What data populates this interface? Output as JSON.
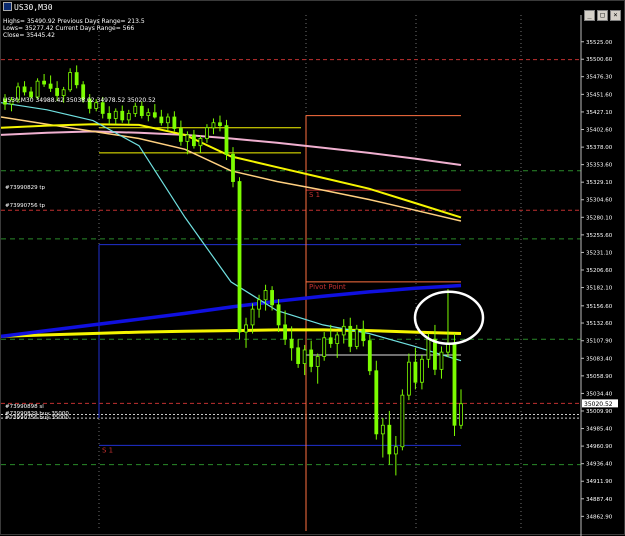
{
  "window": {
    "title": "US30,M30",
    "buttons": [
      "_",
      "□",
      "×"
    ]
  },
  "chart_header": {
    "symbol_line": "US30,M30  34988.42 35038.02 34978.52 35020.52",
    "info_lines": [
      "Highs= 35490.92   Previous Days Range= 213.5",
      "Lows= 35277.42   Current Days Range= 566",
      "Close= 35445.42"
    ]
  },
  "colors": {
    "background": "#000000",
    "candle": "#7cfc00",
    "ema_blue": "#1010e0",
    "ema_yellow": "#f5f500",
    "ma_pink": "#f0b0d0",
    "ma_orange": "#ffb000",
    "ma_gold": "#ffd080",
    "ma_cyan": "#70e0e0",
    "level_red": "#c03030",
    "level_green": "#2a8a2a",
    "pivot_orange": "#ff7040",
    "highlight_circle": "#ffffff"
  },
  "chart_data": {
    "type": "candlestick",
    "title": "US30,M30",
    "ylim": [
      34862.0,
      35540.0
    ],
    "y_ticks": [
      "35525.00",
      "35500.60",
      "35476.30",
      "35451.60",
      "35427.10",
      "35402.60",
      "35378.00",
      "35353.60",
      "35329.10",
      "35304.60",
      "35280.10",
      "35255.60",
      "35231.10",
      "35206.60",
      "35182.10",
      "35156.60",
      "35132.60",
      "35107.90",
      "35083.40",
      "35058.90",
      "35034.40",
      "35009.90",
      "34985.40",
      "34960.90",
      "34936.40",
      "34911.90",
      "34887.40",
      "34862.90"
    ],
    "current_price": "35020.52",
    "candles_ohlc": [
      [
        35445,
        35452,
        35430,
        35438
      ],
      [
        35438,
        35448,
        35428,
        35444
      ],
      [
        35444,
        35468,
        35440,
        35462
      ],
      [
        35462,
        35470,
        35450,
        35455
      ],
      [
        35455,
        35462,
        35445,
        35448
      ],
      [
        35448,
        35474,
        35445,
        35470
      ],
      [
        35470,
        35480,
        35462,
        35466
      ],
      [
        35466,
        35478,
        35455,
        35460
      ],
      [
        35460,
        35470,
        35442,
        35450
      ],
      [
        35450,
        35462,
        35440,
        35458
      ],
      [
        35458,
        35488,
        35455,
        35482
      ],
      [
        35482,
        35492,
        35460,
        35465
      ],
      [
        35465,
        35470,
        35440,
        35445
      ],
      [
        35445,
        35452,
        35425,
        35432
      ],
      [
        35432,
        35445,
        35428,
        35440
      ],
      [
        35440,
        35448,
        35418,
        35425
      ],
      [
        35425,
        35435,
        35410,
        35418
      ],
      [
        35418,
        35432,
        35410,
        35428
      ],
      [
        35428,
        35436,
        35412,
        35416
      ],
      [
        35416,
        35430,
        35410,
        35425
      ],
      [
        35425,
        35440,
        35420,
        35435
      ],
      [
        35435,
        35442,
        35418,
        35422
      ],
      [
        35422,
        35432,
        35414,
        35426
      ],
      [
        35426,
        35438,
        35418,
        35420
      ],
      [
        35420,
        35430,
        35408,
        35412
      ],
      [
        35412,
        35425,
        35402,
        35420
      ],
      [
        35420,
        35428,
        35400,
        35404
      ],
      [
        35404,
        35415,
        35380,
        35386
      ],
      [
        35386,
        35400,
        35368,
        35395
      ],
      [
        35395,
        35402,
        35376,
        35380
      ],
      [
        35380,
        35394,
        35370,
        35390
      ],
      [
        35390,
        35410,
        35384,
        35405
      ],
      [
        35405,
        35418,
        35396,
        35412
      ],
      [
        35412,
        35422,
        35400,
        35408
      ],
      [
        35408,
        35416,
        35360,
        35368
      ],
      [
        35368,
        35378,
        35322,
        35330
      ],
      [
        35330,
        35336,
        35110,
        35120
      ],
      [
        35120,
        35140,
        35098,
        35130
      ],
      [
        35130,
        35160,
        35118,
        35152
      ],
      [
        35152,
        35172,
        35140,
        35165
      ],
      [
        35165,
        35186,
        35150,
        35178
      ],
      [
        35178,
        35184,
        35150,
        35158
      ],
      [
        35158,
        35166,
        35120,
        35130
      ],
      [
        35130,
        35150,
        35102,
        35110
      ],
      [
        35110,
        35128,
        35080,
        35098
      ],
      [
        35098,
        35110,
        35070,
        35076
      ],
      [
        35076,
        35102,
        35060,
        35095
      ],
      [
        35095,
        35108,
        35064,
        35072
      ],
      [
        35072,
        35090,
        35048,
        35086
      ],
      [
        35086,
        35120,
        35080,
        35112
      ],
      [
        35112,
        35130,
        35098,
        35104
      ],
      [
        35104,
        35120,
        35084,
        35116
      ],
      [
        35116,
        35138,
        35104,
        35128
      ],
      [
        35128,
        35140,
        35092,
        35100
      ],
      [
        35100,
        35130,
        35096,
        35124
      ],
      [
        35124,
        35136,
        35100,
        35108
      ],
      [
        35108,
        35116,
        35060,
        35066
      ],
      [
        35066,
        35080,
        34970,
        34978
      ],
      [
        34978,
        35000,
        34945,
        34990
      ],
      [
        34990,
        35010,
        34935,
        34950
      ],
      [
        34950,
        34975,
        34920,
        34960
      ],
      [
        34960,
        35040,
        34955,
        35032
      ],
      [
        35032,
        35090,
        35025,
        35078
      ],
      [
        35078,
        35098,
        35040,
        35050
      ],
      [
        35050,
        35088,
        35040,
        35082
      ],
      [
        35082,
        35118,
        35070,
        35110
      ],
      [
        35110,
        35130,
        35060,
        35068
      ],
      [
        35068,
        35100,
        35055,
        35092
      ],
      [
        35092,
        35180,
        35085,
        35105
      ],
      [
        35105,
        35118,
        34975,
        34990
      ],
      [
        34990,
        35040,
        34985,
        35020
      ]
    ],
    "moving_averages": [
      {
        "color": "yellow-thick",
        "values": [
          35114,
          35116,
          35118,
          35120,
          35121,
          35122,
          35123,
          35123,
          35122,
          35120,
          35118
        ]
      },
      {
        "color": "blue-thick",
        "values": [
          35114,
          35122,
          35130,
          35138,
          35146,
          35155,
          35163,
          35170,
          35176,
          35181,
          35185
        ]
      },
      {
        "color": "pink",
        "values": [
          35395,
          35398,
          35400,
          35398,
          35395,
          35390,
          35384,
          35377,
          35370,
          35362,
          35353
        ]
      },
      {
        "color": "gold",
        "values": [
          35420,
          35410,
          35400,
          35390,
          35375,
          35345,
          35330,
          35318,
          35305,
          35290,
          35275
        ]
      },
      {
        "color": "yellow-thin",
        "values": [
          35405,
          35408,
          35410,
          35409,
          35395,
          35365,
          35350,
          35335,
          35320,
          35300,
          35280
        ]
      },
      {
        "color": "cyan",
        "values": [
          35440,
          35430,
          35415,
          35380,
          35280,
          35190,
          35150,
          35130,
          35118,
          35100,
          35080
        ]
      }
    ],
    "levels": [
      {
        "label": "",
        "price": 35500.0,
        "color": "red-dash"
      },
      {
        "label": "",
        "price": 35422.0,
        "color": "orange"
      },
      {
        "label": "",
        "price": 35405.0,
        "color": "yellow"
      },
      {
        "label": "",
        "price": 35370.0,
        "color": "yellow"
      },
      {
        "label": "",
        "price": 35345.0,
        "color": "green-dash"
      },
      {
        "label": "S 1",
        "price": 35318.0,
        "color": "red"
      },
      {
        "label": "",
        "price": 35290.0,
        "color": "red-dash"
      },
      {
        "label": "",
        "price": 35250.0,
        "color": "green-dash"
      },
      {
        "label": "",
        "price": 35242.0,
        "color": "blue"
      },
      {
        "label": "Pivot Point",
        "price": 35190.0,
        "color": "orange"
      },
      {
        "label": "",
        "price": 35110.0,
        "color": "green-dash"
      },
      {
        "label": "",
        "price": 35088.0,
        "color": "white"
      },
      {
        "label": "",
        "price": 35020.52,
        "color": "red-dash"
      },
      {
        "label": "",
        "price": 35005.0,
        "color": "white-dash"
      },
      {
        "label": "",
        "price": 35000.0,
        "color": "white-dash"
      },
      {
        "label": "S 1",
        "price": 34962.0,
        "color": "blue"
      },
      {
        "label": "",
        "price": 34935.0,
        "color": "green-dash"
      }
    ],
    "order_lines": [
      {
        "text": "#73990829 tp",
        "price": 35315
      },
      {
        "text": "#73990756 tp",
        "price": 35290
      },
      {
        "text": "#73990898 sl",
        "price": 35010
      },
      {
        "text": "#73990829 buy 35000",
        "price": 35000
      },
      {
        "text": "#73990756 buy 35000",
        "price": 34994
      }
    ],
    "annotation": {
      "type": "circle",
      "label": ""
    }
  }
}
